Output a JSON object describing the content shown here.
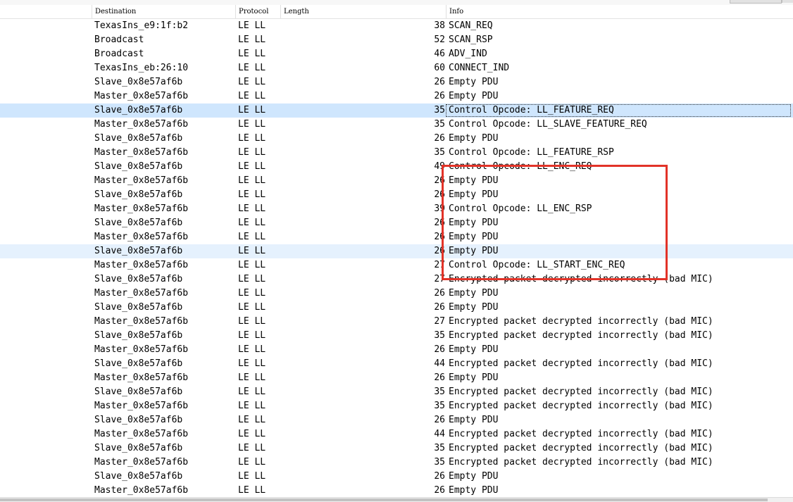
{
  "columns": {
    "destination": "Destination",
    "protocol": "Protocol",
    "length": "Length",
    "info": "Info"
  },
  "packets": [
    {
      "destination": "TexasIns_e9:1f:b2",
      "protocol": "LE LL",
      "length": "38",
      "info": "SCAN_REQ"
    },
    {
      "destination": "Broadcast",
      "protocol": "LE LL",
      "length": "52",
      "info": "SCAN_RSP"
    },
    {
      "destination": "Broadcast",
      "protocol": "LE LL",
      "length": "46",
      "info": "ADV_IND"
    },
    {
      "destination": "TexasIns_eb:26:10",
      "protocol": "LE LL",
      "length": "60",
      "info": "CONNECT_IND"
    },
    {
      "destination": "Slave_0x8e57af6b",
      "protocol": "LE LL",
      "length": "26",
      "info": "Empty PDU"
    },
    {
      "destination": "Master_0x8e57af6b",
      "protocol": "LE LL",
      "length": "26",
      "info": "Empty PDU"
    },
    {
      "destination": "Slave_0x8e57af6b",
      "protocol": "LE LL",
      "length": "35",
      "info": "Control Opcode: LL_FEATURE_REQ"
    },
    {
      "destination": "Master_0x8e57af6b",
      "protocol": "LE LL",
      "length": "35",
      "info": "Control Opcode: LL_SLAVE_FEATURE_REQ"
    },
    {
      "destination": "Slave_0x8e57af6b",
      "protocol": "LE LL",
      "length": "26",
      "info": "Empty PDU"
    },
    {
      "destination": "Master_0x8e57af6b",
      "protocol": "LE LL",
      "length": "35",
      "info": "Control Opcode: LL_FEATURE_RSP"
    },
    {
      "destination": "Slave_0x8e57af6b",
      "protocol": "LE LL",
      "length": "49",
      "info": "Control Opcode: LL_ENC_REQ"
    },
    {
      "destination": "Master_0x8e57af6b",
      "protocol": "LE LL",
      "length": "26",
      "info": "Empty PDU"
    },
    {
      "destination": "Slave_0x8e57af6b",
      "protocol": "LE LL",
      "length": "26",
      "info": "Empty PDU"
    },
    {
      "destination": "Master_0x8e57af6b",
      "protocol": "LE LL",
      "length": "39",
      "info": "Control Opcode: LL_ENC_RSP"
    },
    {
      "destination": "Slave_0x8e57af6b",
      "protocol": "LE LL",
      "length": "26",
      "info": "Empty PDU"
    },
    {
      "destination": "Master_0x8e57af6b",
      "protocol": "LE LL",
      "length": "26",
      "info": "Empty PDU"
    },
    {
      "destination": "Slave_0x8e57af6b",
      "protocol": "LE LL",
      "length": "26",
      "info": "Empty PDU"
    },
    {
      "destination": "Master_0x8e57af6b",
      "protocol": "LE LL",
      "length": "27",
      "info": "Control Opcode: LL_START_ENC_REQ"
    },
    {
      "destination": "Slave_0x8e57af6b",
      "protocol": "LE LL",
      "length": "27",
      "info": "Encrypted packet decrypted incorrectly (bad MIC)"
    },
    {
      "destination": "Master_0x8e57af6b",
      "protocol": "LE LL",
      "length": "26",
      "info": "Empty PDU"
    },
    {
      "destination": "Slave_0x8e57af6b",
      "protocol": "LE LL",
      "length": "26",
      "info": "Empty PDU"
    },
    {
      "destination": "Master_0x8e57af6b",
      "protocol": "LE LL",
      "length": "27",
      "info": "Encrypted packet decrypted incorrectly (bad MIC)"
    },
    {
      "destination": "Slave_0x8e57af6b",
      "protocol": "LE LL",
      "length": "35",
      "info": "Encrypted packet decrypted incorrectly (bad MIC)"
    },
    {
      "destination": "Master_0x8e57af6b",
      "protocol": "LE LL",
      "length": "26",
      "info": "Empty PDU"
    },
    {
      "destination": "Slave_0x8e57af6b",
      "protocol": "LE LL",
      "length": "44",
      "info": "Encrypted packet decrypted incorrectly (bad MIC)"
    },
    {
      "destination": "Master_0x8e57af6b",
      "protocol": "LE LL",
      "length": "26",
      "info": "Empty PDU"
    },
    {
      "destination": "Slave_0x8e57af6b",
      "protocol": "LE LL",
      "length": "35",
      "info": "Encrypted packet decrypted incorrectly (bad MIC)"
    },
    {
      "destination": "Master_0x8e57af6b",
      "protocol": "LE LL",
      "length": "35",
      "info": "Encrypted packet decrypted incorrectly (bad MIC)"
    },
    {
      "destination": "Slave_0x8e57af6b",
      "protocol": "LE LL",
      "length": "26",
      "info": "Empty PDU"
    },
    {
      "destination": "Master_0x8e57af6b",
      "protocol": "LE LL",
      "length": "44",
      "info": "Encrypted packet decrypted incorrectly (bad MIC)"
    },
    {
      "destination": "Slave_0x8e57af6b",
      "protocol": "LE LL",
      "length": "35",
      "info": "Encrypted packet decrypted incorrectly (bad MIC)"
    },
    {
      "destination": "Master_0x8e57af6b",
      "protocol": "LE LL",
      "length": "35",
      "info": "Encrypted packet decrypted incorrectly (bad MIC)"
    },
    {
      "destination": "Slave_0x8e57af6b",
      "protocol": "LE LL",
      "length": "26",
      "info": "Empty PDU"
    },
    {
      "destination": "Master_0x8e57af6b",
      "protocol": "LE LL",
      "length": "26",
      "info": "Empty PDU"
    }
  ],
  "selected_row": 6,
  "light_highlight_row": 16,
  "colors": {
    "selected_row": "#cfe6fd",
    "light_row": "#e5f1fd",
    "annotation_box": "#e23328"
  }
}
